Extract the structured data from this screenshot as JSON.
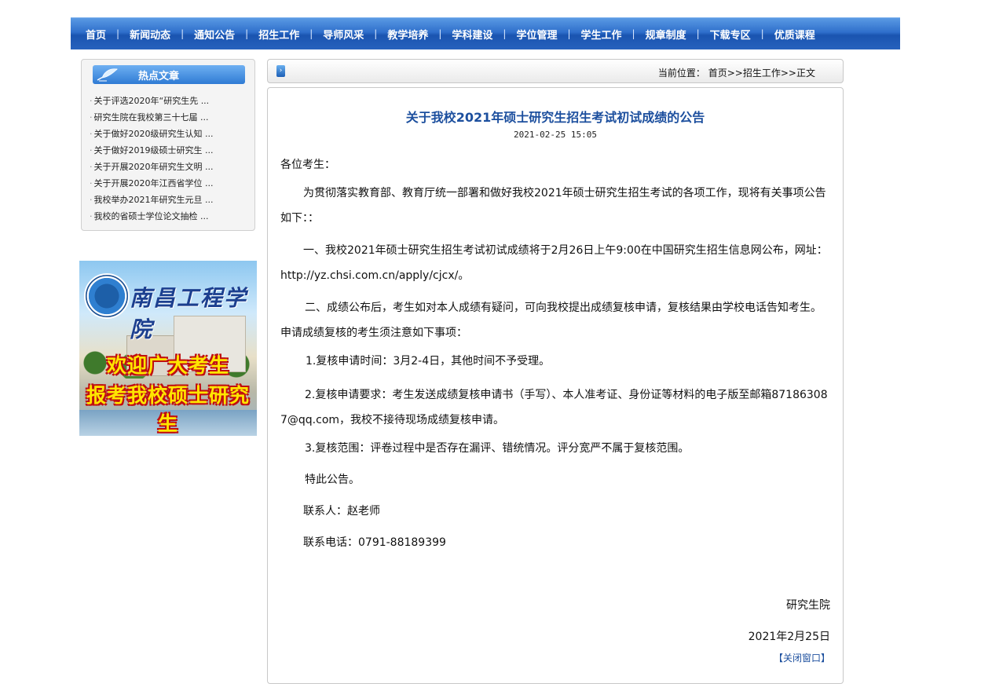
{
  "nav": {
    "items": [
      "首页",
      "新闻动态",
      "通知公告",
      "招生工作",
      "导师风采",
      "教学培养",
      "学科建设",
      "学位管理",
      "学生工作",
      "规章制度",
      "下载专区",
      "优质课程"
    ],
    "separator": "|"
  },
  "hot": {
    "title": "热点文章",
    "bullet": "·",
    "items": [
      "关于评选2020年“研究生先 ...",
      "研究生院在我校第三十七届 ...",
      "关于做好2020级研究生认知 ...",
      "关于做好2019级硕士研究生 ...",
      "关于开展2020年研究生文明 ...",
      "关于开展2020年江西省学位 ...",
      "我校举办2021年研究生元旦 ...",
      "我校的省硕士学位论文抽检 ..."
    ]
  },
  "banner": {
    "school_name": "南昌工程学院",
    "slogan_line1": "欢迎广大考生",
    "slogan_line2": "报考我校硕士研究生"
  },
  "breadcrumb": {
    "label": "当前位置：",
    "home": "首页",
    "sep": ">>",
    "section": "招生工作",
    "current": "正文"
  },
  "article": {
    "title": "关于我校2021年硕士研究生招生考试初试成绩的公告",
    "date": "2021-02-25 15:05",
    "greeting": "各位考生：",
    "p1": "为贯彻落实教育部、教育厅统一部署和做好我校2021年硕士研究生招生考试的各项工作，现将有关事项公告如下：：",
    "p2": "一、我校2021年硕士研究生招生考试初试成绩将于2月26日上午9:00在中国研究生招生信息网公布，网址：http://yz.chsi.com.cn/apply/cjcx/。",
    "p3": "二、成绩公布后，考生如对本人成绩有疑问，可向我校提出成绩复核申请，复核结果由学校电话告知考生。申请成绩复核的考生须注意如下事项：",
    "p4": "1.复核申请时间：3月2-4日，其他时间不予受理。",
    "p5": "2.复核申请要求：考生发送成绩复核申请书（手写）、本人准考证、身份证等材料的电子版至邮箱871863087@qq.com，我校不接待现场成绩复核申请。",
    "p6": "3.复核范围：评卷过程中是否存在漏评、错统情况。评分宽严不属于复核范围。",
    "p7": "特此公告。",
    "contact_person": "联系人：赵老师",
    "contact_phone": "联系电话：0791-88189399",
    "signature": "研究生院",
    "sign_date": "2021年2月25日",
    "close_link": "【关闭窗口】"
  },
  "colors": {
    "nav_bg": "#2f6fcb",
    "title": "#1c4f9e",
    "slogan": "#ffe600"
  }
}
